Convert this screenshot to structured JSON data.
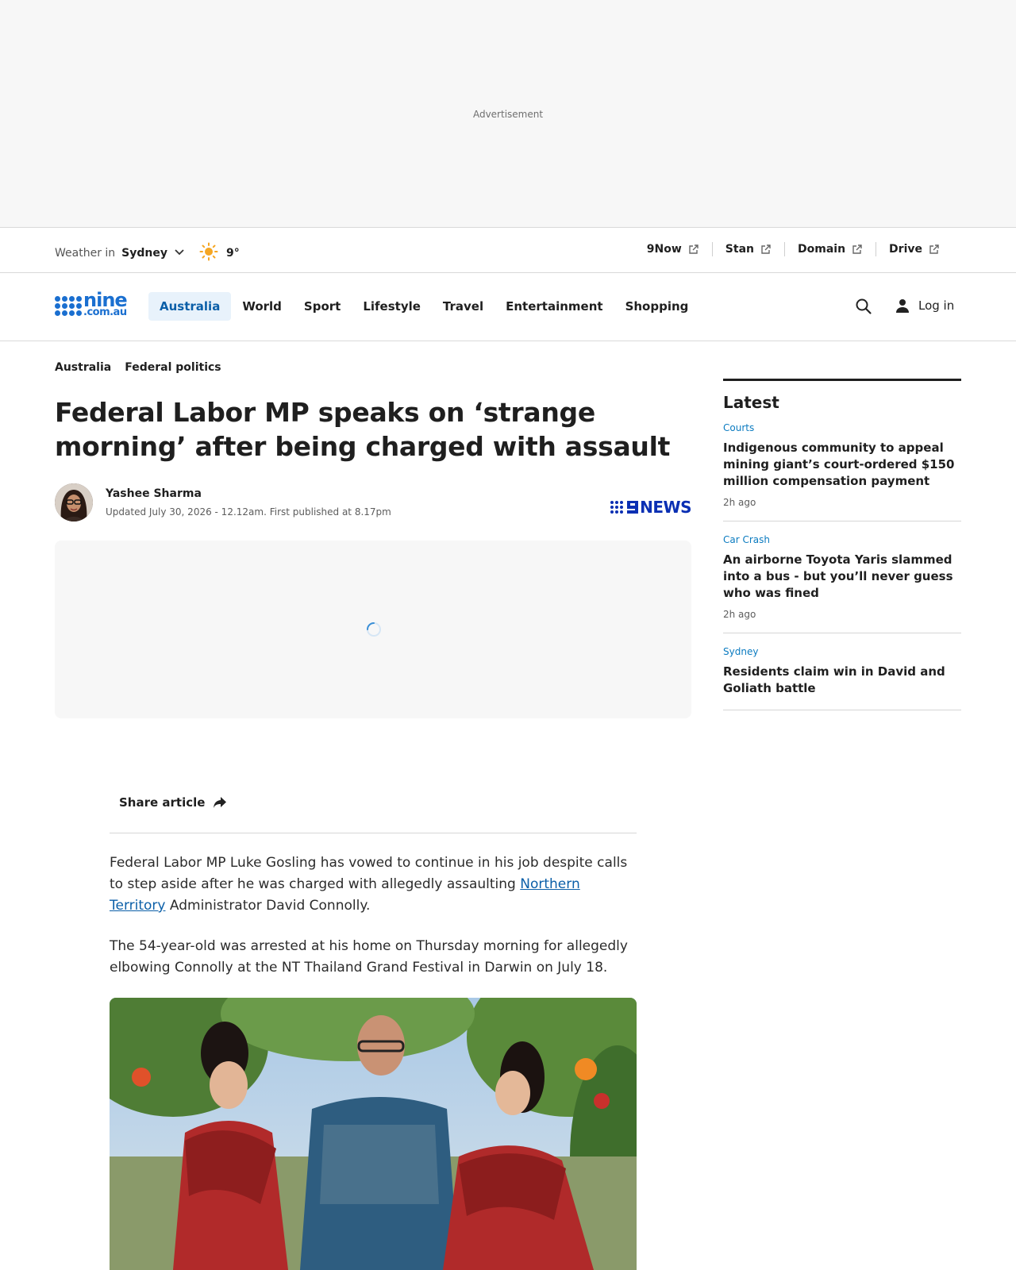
{
  "ad": {
    "label": "Advertisement"
  },
  "weather": {
    "label": "Weather in",
    "city": "Sydney",
    "temp": "9°",
    "icon": "sun-icon"
  },
  "partners": [
    {
      "label": "9Now",
      "icon": "external-link-icon"
    },
    {
      "label": "Stan",
      "icon": "external-link-icon"
    },
    {
      "label": "Domain",
      "icon": "external-link-icon"
    },
    {
      "label": "Drive",
      "icon": "external-link-icon"
    }
  ],
  "logo": {
    "line1": "nine",
    "line2": ".com.au"
  },
  "nav": {
    "items": [
      {
        "label": "Australia",
        "active": true
      },
      {
        "label": "World"
      },
      {
        "label": "Sport"
      },
      {
        "label": "Lifestyle"
      },
      {
        "label": "Travel"
      },
      {
        "label": "Entertainment"
      },
      {
        "label": "Shopping"
      }
    ],
    "login": "Log in"
  },
  "breadcrumb": [
    "Australia",
    "Federal politics"
  ],
  "article": {
    "headline": "Federal Labor MP speaks on ‘strange morning’ after being charged with assault",
    "author": "Yashee Sharma",
    "dates": "Updated July 30, 2026 - 12.12am. First published at 8.17pm",
    "brand": "NEWS",
    "share": "Share article",
    "para1_a": "Federal Labor MP Luke Gosling has vowed to continue in his job despite calls to step aside after he was charged with allegedly assaulting ",
    "para1_link": "Northern Territory",
    "para1_b": " Administrator David Connolly.",
    "para2": "The 54-year-old was arrested at his home on Thursday morning for allegedly elbowing Connolly at the NT Thailand Grand Festival in Darwin on July 18."
  },
  "sidebar": {
    "title": "Latest",
    "items": [
      {
        "category": "Courts",
        "title": "Indigenous community to appeal mining giant’s court-ordered $150 million compensation payment",
        "ago": "2h ago"
      },
      {
        "category": "Car Crash",
        "title": "An airborne Toyota Yaris slammed into a bus - but you’ll never guess who was fined",
        "ago": "2h ago"
      },
      {
        "category": "Sydney",
        "title": "Residents claim win in David and Goliath battle",
        "ago": ""
      }
    ]
  }
}
